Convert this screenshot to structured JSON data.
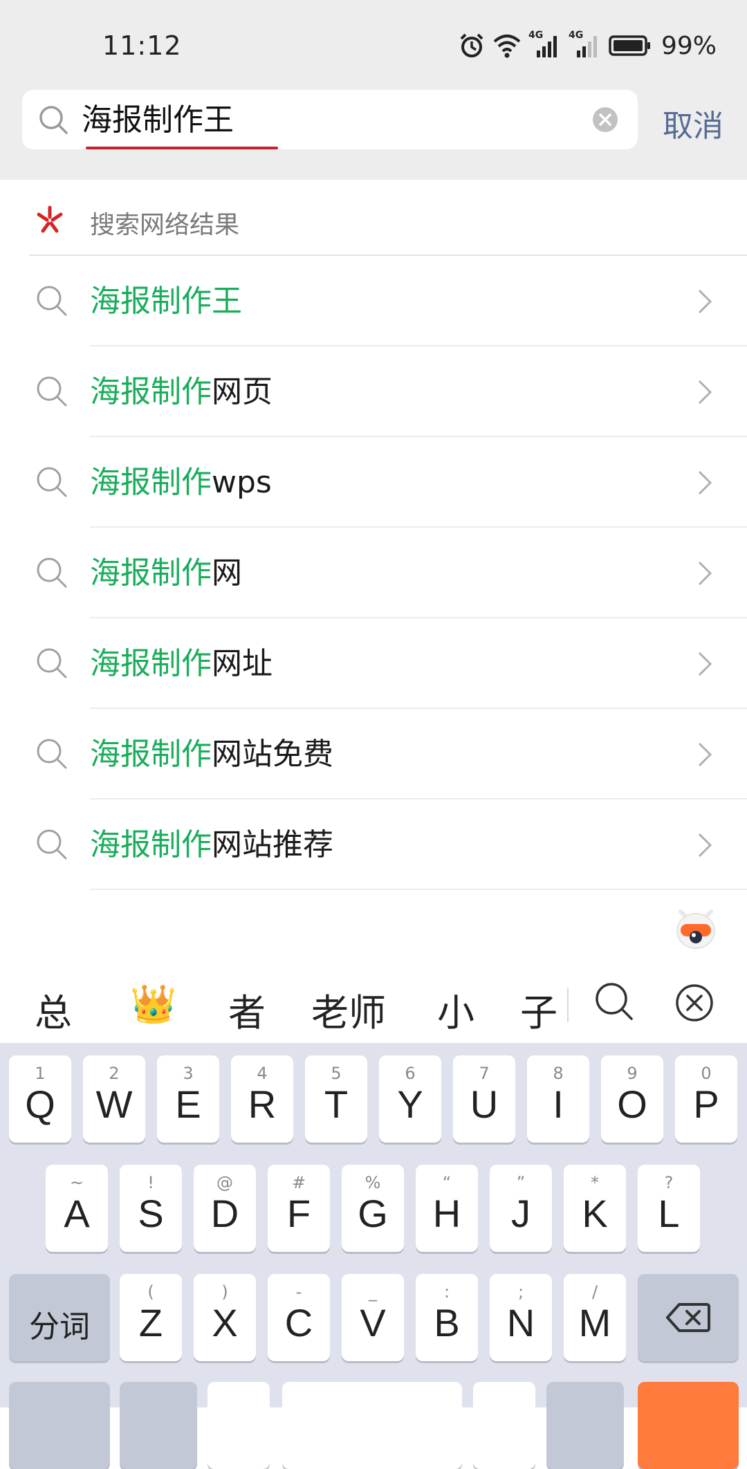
{
  "status_bar": {
    "time": "11:12",
    "battery_percent": "99%",
    "network_1": "4G",
    "network_2": "4G"
  },
  "search": {
    "query": "海报制作王",
    "cancel_label": "取消"
  },
  "results": {
    "web_header_label": "搜索网络结果",
    "items": [
      {
        "highlight": "海报制作王",
        "rest": ""
      },
      {
        "highlight": "海报制作",
        "rest": "网页"
      },
      {
        "highlight": "海报制作",
        "rest": "wps"
      },
      {
        "highlight": "海报制作",
        "rest": "网"
      },
      {
        "highlight": "海报制作",
        "rest": "网址"
      },
      {
        "highlight": "海报制作",
        "rest": "网站免费"
      },
      {
        "highlight": "海报制作",
        "rest": "网站推荐"
      }
    ]
  },
  "ime": {
    "candidates": [
      "总",
      "👑",
      "者",
      "老师",
      "小",
      "子"
    ]
  },
  "keyboard": {
    "row1": [
      {
        "main": "Q",
        "sub": "1"
      },
      {
        "main": "W",
        "sub": "2"
      },
      {
        "main": "E",
        "sub": "3"
      },
      {
        "main": "R",
        "sub": "4"
      },
      {
        "main": "T",
        "sub": "5"
      },
      {
        "main": "Y",
        "sub": "6"
      },
      {
        "main": "U",
        "sub": "7"
      },
      {
        "main": "I",
        "sub": "8"
      },
      {
        "main": "O",
        "sub": "9"
      },
      {
        "main": "P",
        "sub": "0"
      }
    ],
    "row2": [
      {
        "main": "A",
        "sub": "~"
      },
      {
        "main": "S",
        "sub": "!"
      },
      {
        "main": "D",
        "sub": "@"
      },
      {
        "main": "F",
        "sub": "#"
      },
      {
        "main": "G",
        "sub": "%"
      },
      {
        "main": "H",
        "sub": "“"
      },
      {
        "main": "J",
        "sub": "”"
      },
      {
        "main": "K",
        "sub": "*"
      },
      {
        "main": "L",
        "sub": "?"
      }
    ],
    "row3": [
      {
        "main": "Z",
        "sub": "("
      },
      {
        "main": "X",
        "sub": ")"
      },
      {
        "main": "C",
        "sub": "-"
      },
      {
        "main": "V",
        "sub": "_"
      },
      {
        "main": "B",
        "sub": ":"
      },
      {
        "main": "N",
        "sub": ";"
      },
      {
        "main": "M",
        "sub": "/"
      }
    ],
    "split_label": "分词"
  },
  "colors": {
    "highlight": "#1aad5b",
    "cancel": "#576b95",
    "underline": "#c8202c"
  }
}
